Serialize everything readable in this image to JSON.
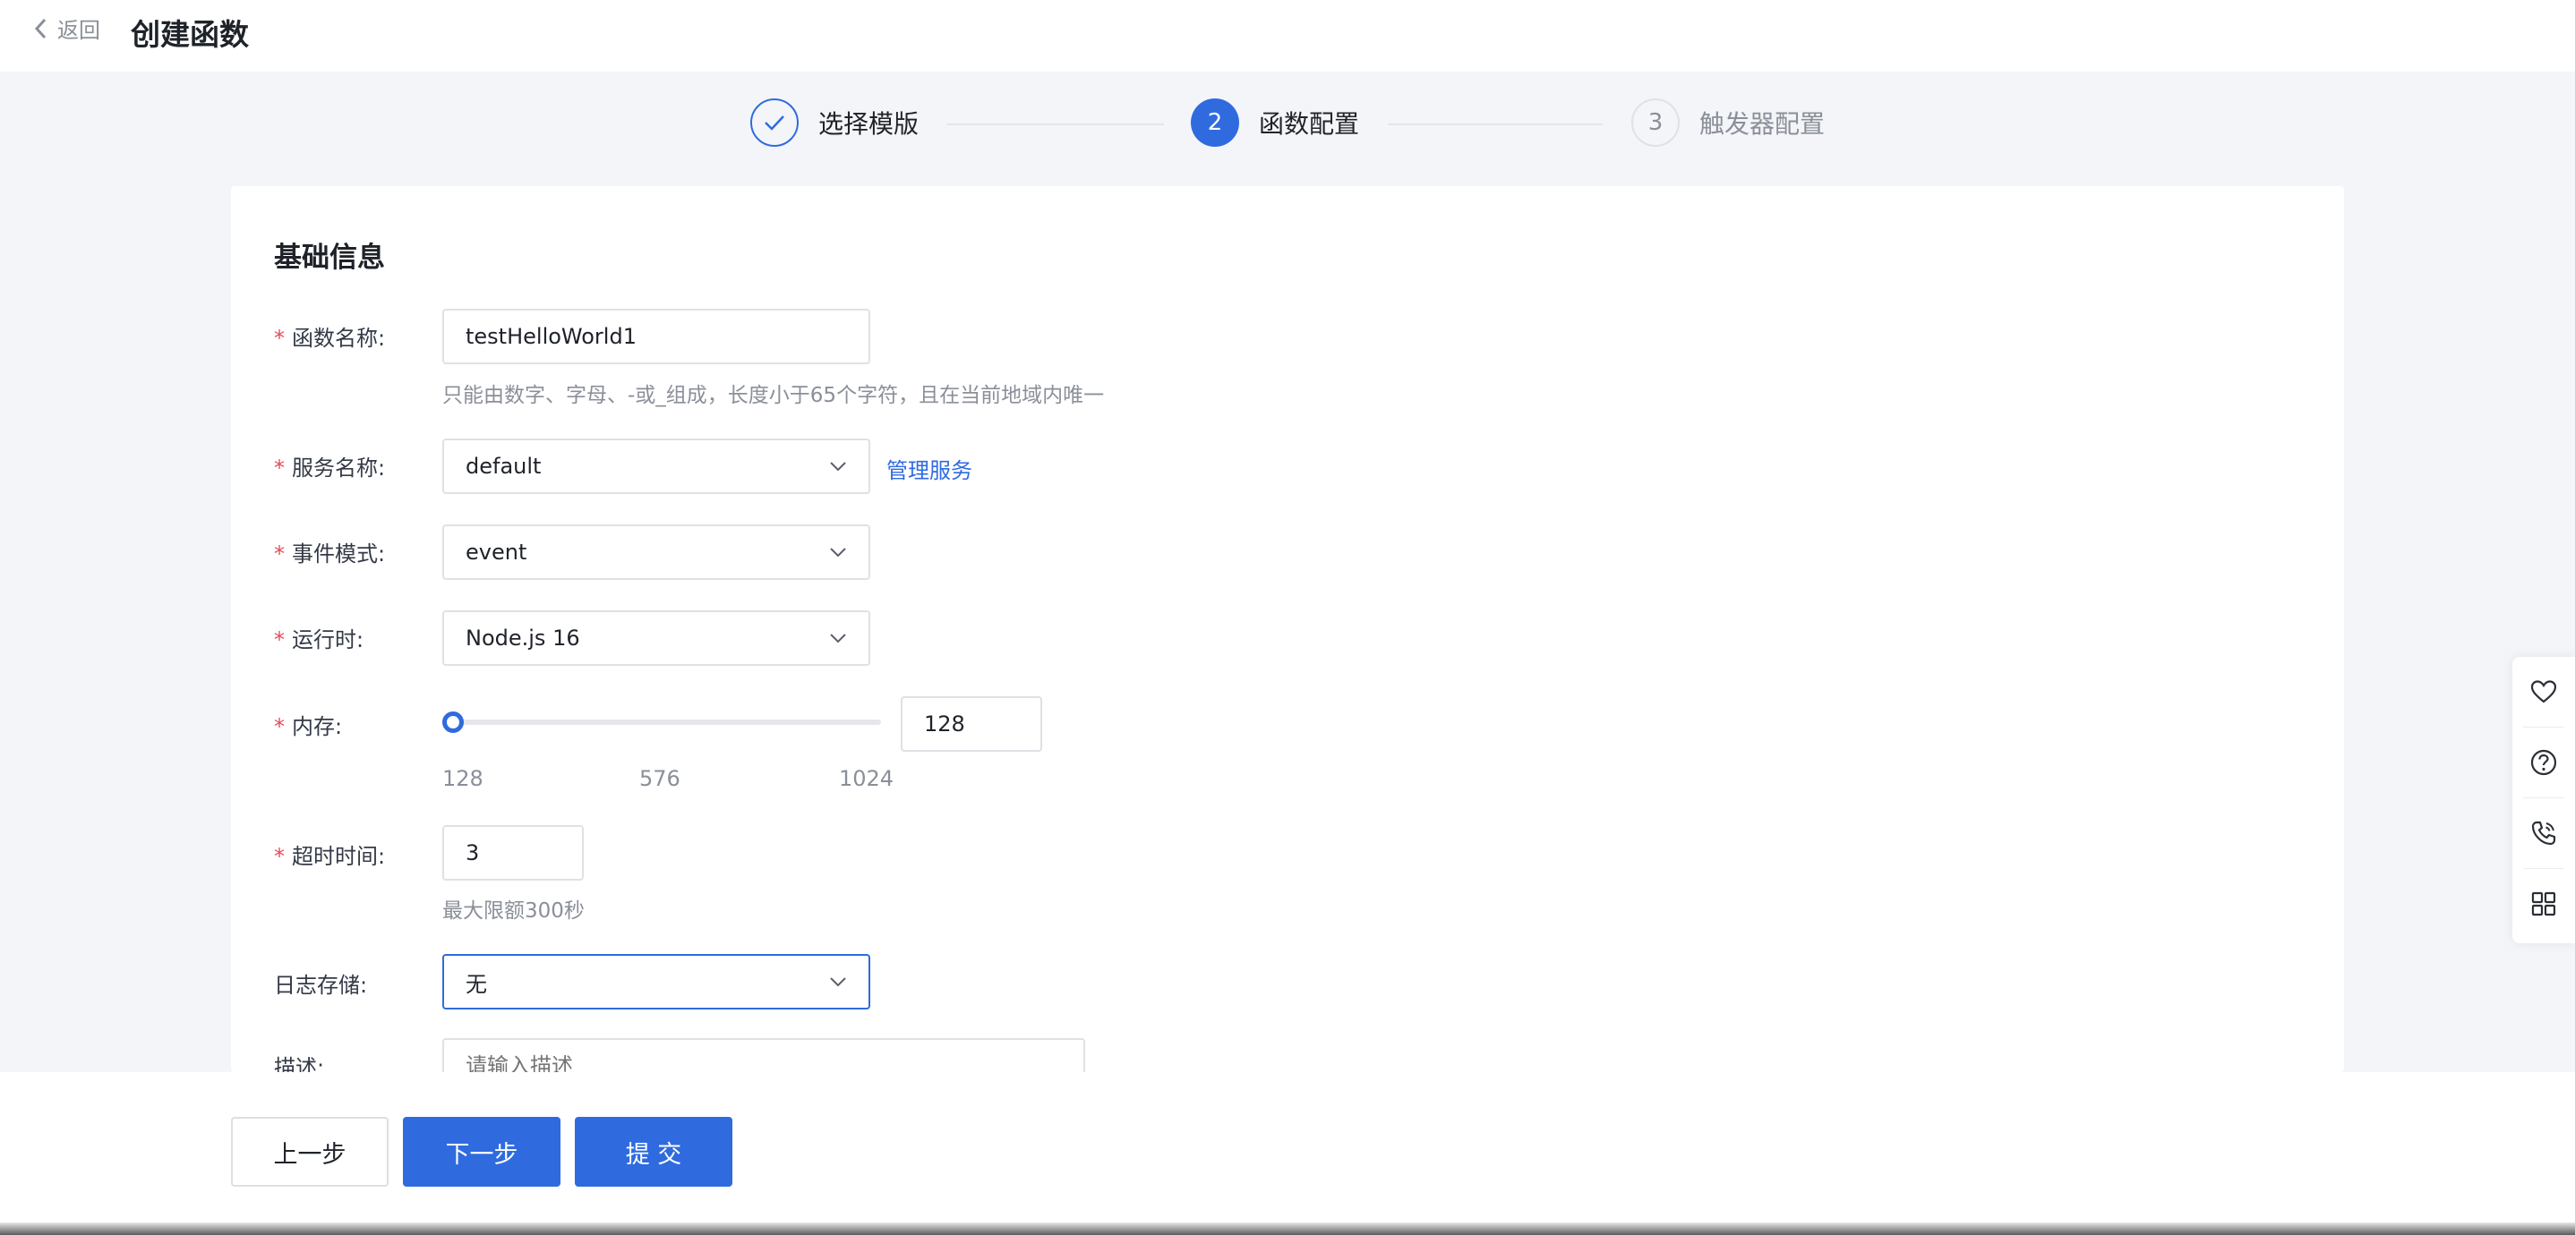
{
  "header": {
    "back_label": "返回",
    "title": "创建函数"
  },
  "steps": [
    {
      "number": "1",
      "label": "选择模版",
      "status": "done"
    },
    {
      "number": "2",
      "label": "函数配置",
      "status": "active"
    },
    {
      "number": "3",
      "label": "触发器配置",
      "status": "pending"
    }
  ],
  "colors": {
    "primary": "#2f6bdf",
    "required": "#e34d59"
  },
  "form": {
    "section_title": "基础信息",
    "required_mark": "*",
    "function_name": {
      "label": "函数名称:",
      "value": "testHelloWorld1",
      "hint": "只能由数字、字母、-或_组成，长度小于65个字符，且在当前地域内唯一"
    },
    "service": {
      "label": "服务名称:",
      "value": "default",
      "link": "管理服务"
    },
    "event_mode": {
      "label": "事件模式:",
      "value": "event"
    },
    "runtime": {
      "label": "运行时:",
      "value": "Node.js 16"
    },
    "memory": {
      "label": "内存:",
      "value": "128",
      "min": 128,
      "max": 1024,
      "ticks": [
        "128",
        "576",
        "1024"
      ]
    },
    "timeout": {
      "label": "超时时间:",
      "value": "3",
      "hint": "最大限额300秒"
    },
    "log_storage": {
      "label": "日志存储:",
      "value": "无"
    },
    "description": {
      "label": "描述:",
      "placeholder": "请输入描述"
    }
  },
  "footer": {
    "prev_label": "上一步",
    "next_label": "下一步",
    "submit_label": "提 交"
  },
  "side_toolbar": [
    "heart-icon",
    "help-icon",
    "phone-icon",
    "apps-icon"
  ]
}
